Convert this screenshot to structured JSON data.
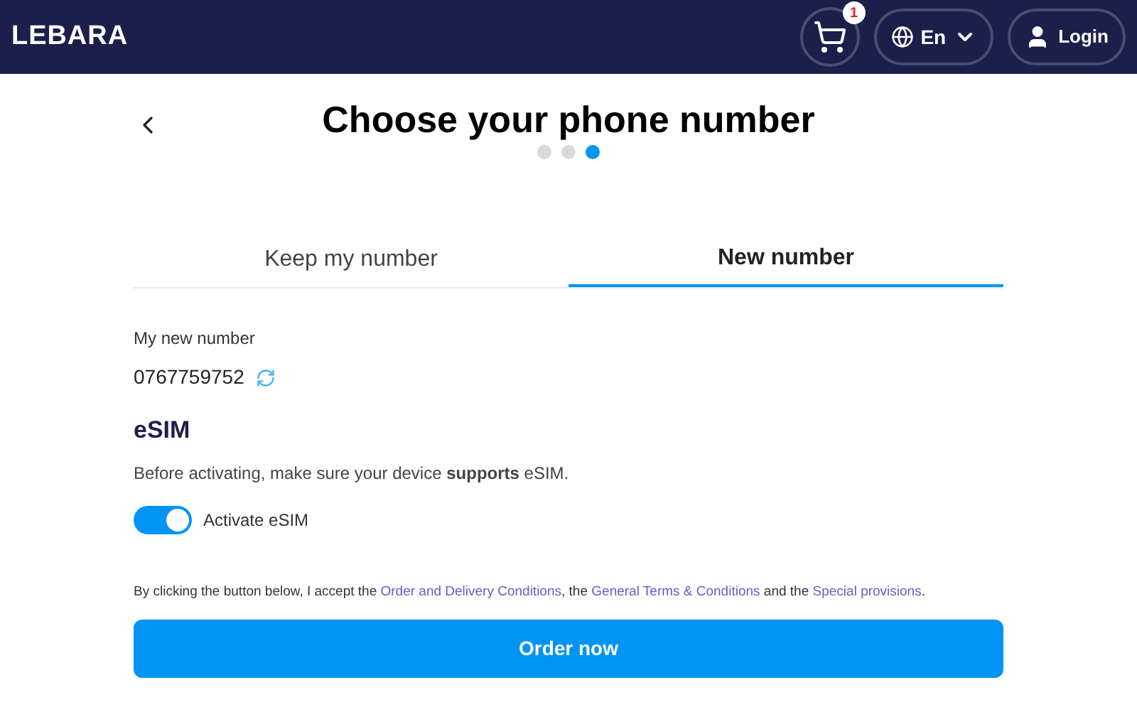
{
  "header": {
    "logo": "LEBARA",
    "cart_count": "1",
    "language": "En",
    "login": "Login"
  },
  "title": "Choose your phone number",
  "steps": [
    {
      "selected": false
    },
    {
      "selected": false
    },
    {
      "selected": true
    }
  ],
  "tabs": [
    {
      "label": "Keep my number",
      "selected": false
    },
    {
      "label": "New number",
      "selected": true
    }
  ],
  "number": {
    "label": "My new number",
    "value": "0767759752"
  },
  "esim": {
    "heading": "eSIM",
    "note": "Before activating, make sure your device **supports** eSIM.",
    "toggle": {
      "label": "Activate eSIM",
      "on": true
    }
  },
  "terms": [
    {
      "kind": "text",
      "text": "By clicking the button below, I accept the "
    },
    {
      "kind": "link",
      "text": "Order and Delivery Conditions"
    },
    {
      "kind": "text",
      "text": ", the "
    },
    {
      "kind": "link",
      "text": "General Terms & Conditions"
    },
    {
      "kind": "text",
      "text": " and the "
    },
    {
      "kind": "link",
      "text": "Special provisions"
    },
    {
      "kind": "text",
      "text": "."
    }
  ],
  "button": "Order now"
}
